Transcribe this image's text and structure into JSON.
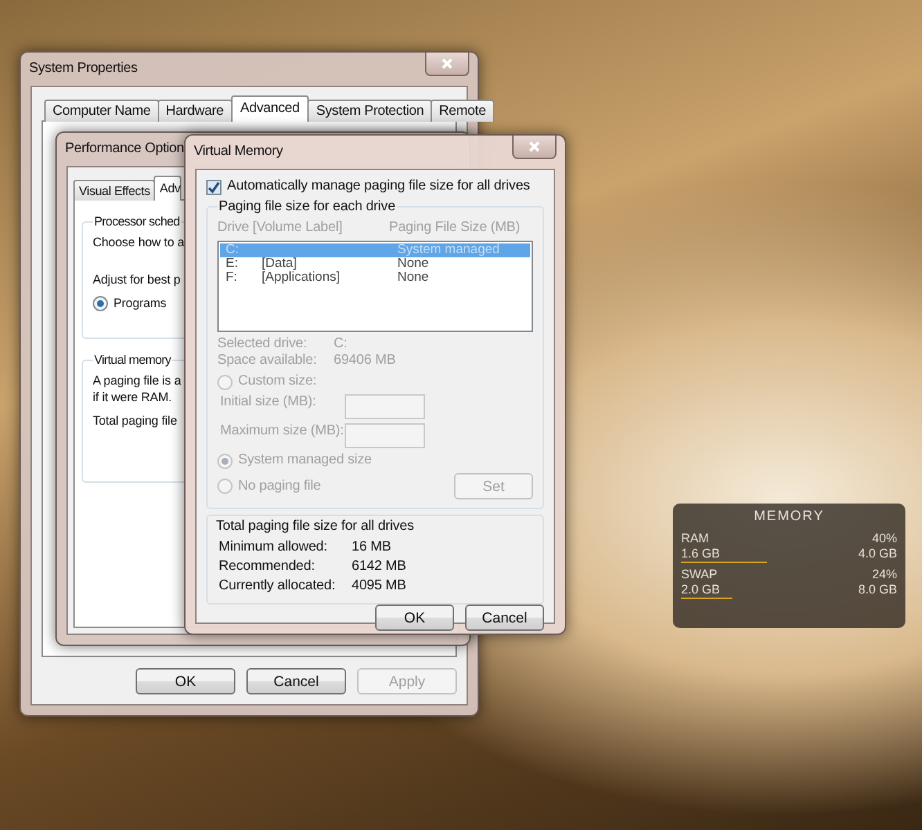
{
  "system_properties": {
    "title": "System Properties",
    "tabs": [
      {
        "label": "Computer Name",
        "selected": false
      },
      {
        "label": "Hardware",
        "selected": false
      },
      {
        "label": "Advanced",
        "selected": true
      },
      {
        "label": "System Protection",
        "selected": false
      },
      {
        "label": "Remote",
        "selected": false
      }
    ],
    "buttons": [
      {
        "label": "OK",
        "disabled": false
      },
      {
        "label": "Cancel",
        "disabled": false
      },
      {
        "label": "Apply",
        "disabled": true
      }
    ]
  },
  "performance_options": {
    "title": "Performance Option",
    "tabs": [
      {
        "label": "Visual Effects",
        "selected": false
      },
      {
        "label": "Adv",
        "selected": true
      }
    ],
    "processor_group": {
      "title": "Processor sched",
      "text_1": "Choose how to a",
      "text_2": "Adjust for best p",
      "option": {
        "label": "Programs",
        "selected": true
      }
    },
    "virtual_memory_group": {
      "title": "Virtual memory",
      "text_1": "A paging file is a",
      "text_2": "if it were RAM.",
      "text_3": "Total paging file"
    }
  },
  "virtual_memory": {
    "title": "Virtual Memory",
    "auto_manage": {
      "label": "Automatically manage paging file size for all drives",
      "checked": true
    },
    "drive_group": {
      "title": "Paging file size for each drive",
      "disabled": true,
      "columns": [
        "Drive [Volume Label]",
        "Paging File Size (MB)"
      ],
      "drives": [
        {
          "drive": "C:",
          "size": "System managed",
          "selected": true
        },
        {
          "drive": "E:",
          "label": "[Data]",
          "size": "None",
          "selected": false
        },
        {
          "drive": "F:",
          "label": "[Applications]",
          "size": "None",
          "selected": false
        }
      ],
      "selected_drive": {
        "label": "Selected drive:",
        "value": "C:"
      },
      "space_available": {
        "label": "Space available:",
        "value": "69406 MB"
      },
      "custom_size": {
        "label": "Custom size:",
        "selected": false
      },
      "initial_size": {
        "label": "Initial size (MB):"
      },
      "maximum_size": {
        "label": "Maximum size (MB):"
      },
      "system_managed": {
        "label": "System managed size",
        "selected": true
      },
      "no_paging": {
        "label": "No paging file",
        "selected": false
      },
      "set_button": {
        "label": "Set"
      }
    },
    "totals": {
      "title": "Total paging file size for all drives",
      "rows": [
        {
          "label": "Minimum allowed:",
          "value": "16 MB"
        },
        {
          "label": "Recommended:",
          "value": "6142 MB"
        },
        {
          "label": "Currently allocated:",
          "value": "4095 MB"
        }
      ]
    },
    "buttons": [
      {
        "label": "OK",
        "disabled": false
      },
      {
        "label": "Cancel",
        "disabled": false
      }
    ]
  },
  "memory_widget": {
    "title": "MEMORY",
    "meters": [
      {
        "name": "RAM",
        "percent": "40%",
        "used": "1.6 GB",
        "total": "4.0 GB",
        "level": 0.4
      },
      {
        "name": "SWAP",
        "percent": "24%",
        "used": "2.0 GB",
        "total": "8.0 GB",
        "level": 0.24
      }
    ]
  }
}
